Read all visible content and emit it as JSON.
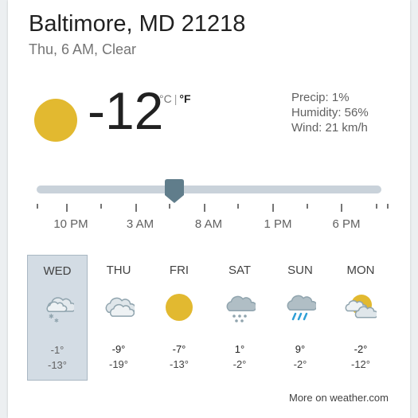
{
  "location": "Baltimore, MD 21218",
  "subtitle": "Thu, 6 AM, Clear",
  "current": {
    "condition_icon": "sun-icon",
    "temperature": "-12",
    "unit_c": "°C",
    "unit_separator": "|",
    "unit_f": "°F",
    "precip": "Precip: 1%",
    "humidity": "Humidity: 56%",
    "wind": "Wind: 21 km/h"
  },
  "timeline": {
    "labels": [
      "10 PM",
      "3 AM",
      "8 AM",
      "1 PM",
      "6 PM"
    ],
    "position_fraction": 0.4
  },
  "forecast": [
    {
      "day": "WED",
      "icon": "snow-cloud-icon",
      "high": "-1°",
      "low": "-13°",
      "selected": true
    },
    {
      "day": "THU",
      "icon": "cloudy-icon",
      "high": "-9°",
      "low": "-19°",
      "selected": false
    },
    {
      "day": "FRI",
      "icon": "sun-icon",
      "high": "-7°",
      "low": "-13°",
      "selected": false
    },
    {
      "day": "SAT",
      "icon": "snow-icon",
      "high": "1°",
      "low": "-2°",
      "selected": false
    },
    {
      "day": "SUN",
      "icon": "rain-icon",
      "high": "9°",
      "low": "-2°",
      "selected": false
    },
    {
      "day": "MON",
      "icon": "partly-cloudy-icon",
      "high": "-2°",
      "low": "-12°",
      "selected": false
    }
  ],
  "more_link": "More on weather.com",
  "colors": {
    "sun": "#e2b930",
    "cloud": "#b0bec5",
    "cloud_dark": "#90a4ae",
    "rain": "#2f9fd6",
    "slider": "#c9d2da",
    "handle": "#607d8b",
    "selected_day": "#d3dce4"
  }
}
